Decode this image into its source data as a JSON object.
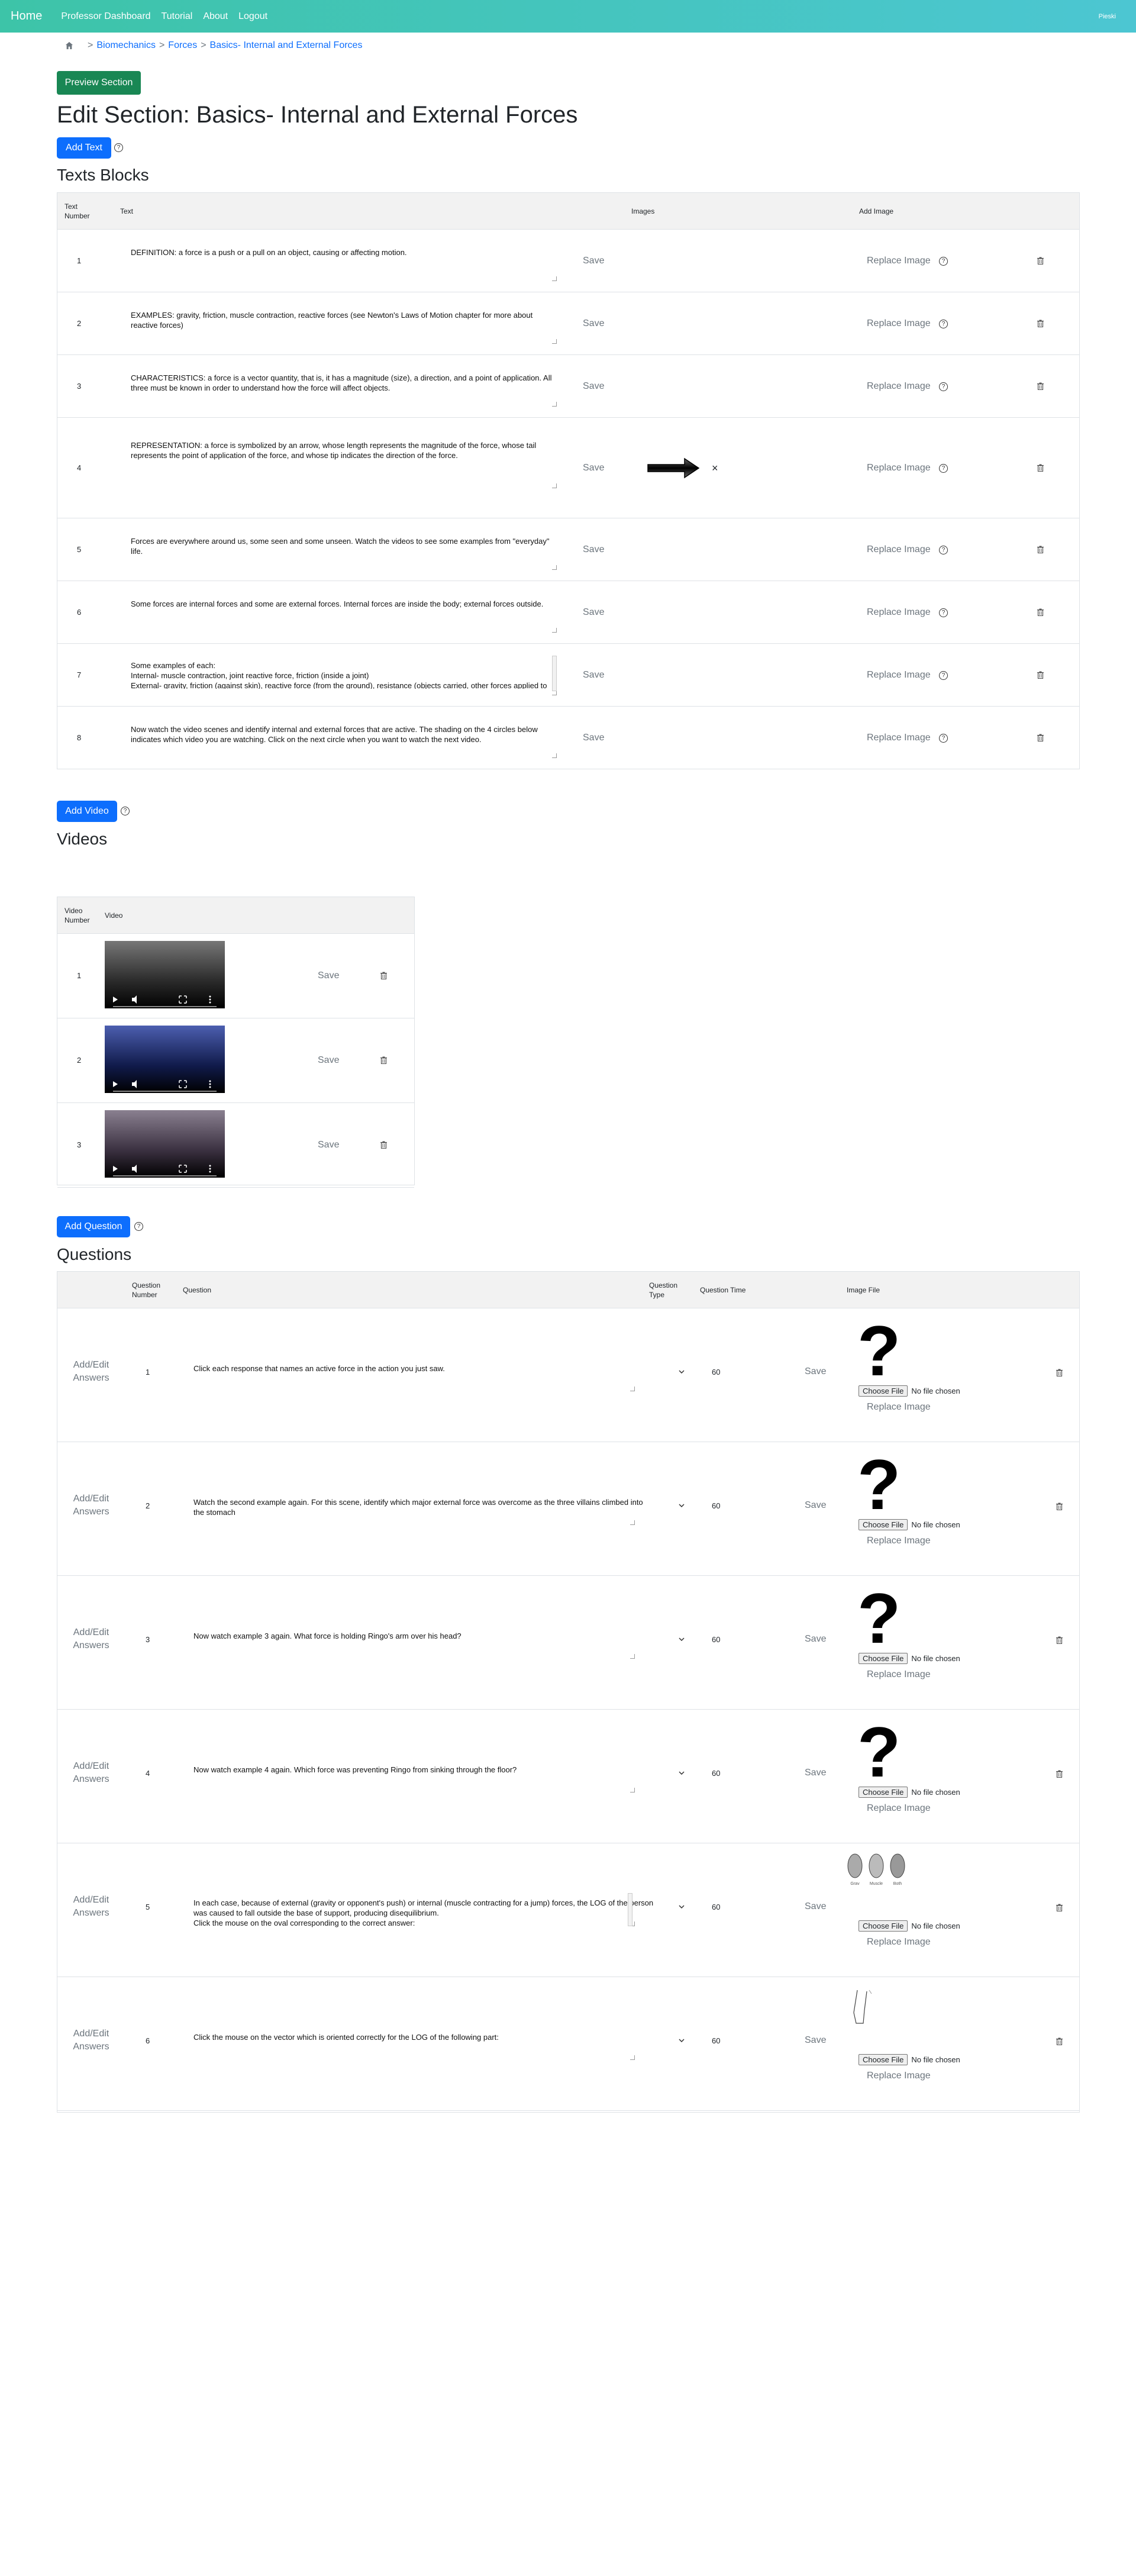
{
  "nav": {
    "brand": "Home",
    "links": [
      "Professor Dashboard",
      "Tutorial",
      "About",
      "Logout"
    ],
    "right": "Pieski"
  },
  "breadcrumb": {
    "items": [
      "Biomechanics",
      "Forces",
      "Basics- Internal and External Forces"
    ],
    "sep": ">"
  },
  "preview_button": "Preview Section",
  "page_title": "Edit Section: Basics- Internal and External Forces",
  "add_text_button": "Add Text",
  "help_glyph": "?",
  "texts_title": "Texts Blocks",
  "texts_headers": {
    "number": "Text Number",
    "text": "Text",
    "images": "Images",
    "add_image": "Add Image"
  },
  "texts": [
    {
      "n": "1",
      "text": "DEFINITION: a force is a push or a pull on an object, causing or affecting motion."
    },
    {
      "n": "2",
      "text": "EXAMPLES: gravity, friction, muscle contraction, reactive forces (see Newton's Laws of Motion chapter for more about reactive forces)"
    },
    {
      "n": "3",
      "text": "CHARACTERISTICS: a force is a vector quantity, that is, it has a magnitude (size), a direction, and a point of application. All three must be known in order to understand how the force will affect objects."
    },
    {
      "n": "4",
      "text": "REPRESENTATION: a force is symbolized by an arrow, whose length represents the magnitude of the force, whose tail represents the point of application of the force, and whose tip indicates the direction of the force."
    },
    {
      "n": "5",
      "text": "Forces are everywhere around us, some seen and some unseen. Watch the videos to see some examples from \"everyday\" life."
    },
    {
      "n": "6",
      "text": "Some forces are internal forces and some are external forces. Internal forces are inside the body; external forces outside."
    },
    {
      "n": "7",
      "text": "Some examples of each:\nInternal- muscle contraction, joint reactive force, friction (inside a joint)\nExternal- gravity, friction (against skin), reactive force (from the ground), resistance (objects carried, other forces applied to"
    },
    {
      "n": "8",
      "text": "Now watch the video scenes and identify internal and external forces that are active. The shading on the 4 circles below indicates which video you are watching. Click on the next circle when you want to watch the next video."
    }
  ],
  "save_label": "Save",
  "replace_image_label": "Replace Image",
  "remove_glyph": "×",
  "add_video_button": "Add Video",
  "videos_title": "Videos",
  "videos_headers": {
    "number": "Video Number",
    "video": "Video"
  },
  "videos": [
    {
      "n": "1"
    },
    {
      "n": "2"
    },
    {
      "n": "3"
    }
  ],
  "add_question_button": "Add Question",
  "questions_title": "Questions",
  "questions_headers": {
    "number": "Question Number",
    "question": "Question",
    "type": "Question Type",
    "time": "Question Time",
    "image": "Image File"
  },
  "add_edit_answers": "Add/Edit Answers",
  "choose_file": "Choose File",
  "no_file": "No file chosen",
  "qmark_glyph": "?",
  "questions": [
    {
      "n": "1",
      "text": "Click each response that names an active force in the action you just saw.",
      "time": "60"
    },
    {
      "n": "2",
      "text": "Watch the second example again. For this scene, identify which major external force was overcome as the three villains climbed into the stomach",
      "time": "60"
    },
    {
      "n": "3",
      "text": "Now watch example 3 again. What force is holding Ringo's arm over his head?",
      "time": "60"
    },
    {
      "n": "4",
      "text": "Now watch example 4 again. Which force was preventing Ringo from sinking through the floor?",
      "time": "60"
    },
    {
      "n": "5",
      "text": "In each case, because of external (gravity or opponent's push) or internal (muscle contracting for a jump) forces, the LOG of the person was caused to fall outside the base of support, producing disequilibrium.\nClick the mouse on the oval corresponding to the correct answer:",
      "time": "60"
    },
    {
      "n": "6",
      "text": "Click the mouse on the vector which is oriented correctly for the LOG of the following part:",
      "time": "60"
    }
  ],
  "oval_labels": [
    "Grav",
    "Muscle",
    "Both"
  ]
}
